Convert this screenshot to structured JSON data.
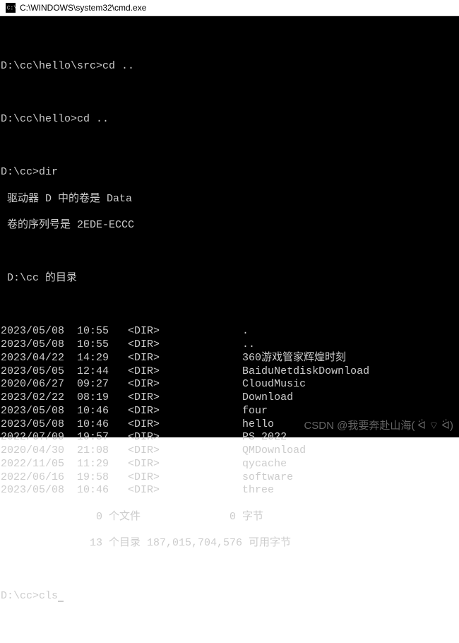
{
  "window": {
    "title": "C:\\WINDOWS\\system32\\cmd.exe"
  },
  "session": {
    "prompt1": "D:\\cc\\hello\\src>",
    "cmd1": "cd ..",
    "prompt2": "D:\\cc\\hello>",
    "cmd2": "cd ..",
    "prompt3": "D:\\cc>",
    "cmd3": "dir",
    "vol_line": " 驱动器 D 中的卷是 Data",
    "serial_line": " 卷的序列号是 2EDE-ECCC",
    "dir_of_line": " D:\\cc 的目录",
    "entries": [
      {
        "date": "2023/05/08",
        "time": "10:55",
        "type": "<DIR>",
        "name": "."
      },
      {
        "date": "2023/05/08",
        "time": "10:55",
        "type": "<DIR>",
        "name": ".."
      },
      {
        "date": "2023/04/22",
        "time": "14:29",
        "type": "<DIR>",
        "name": "360游戏管家辉煌时刻"
      },
      {
        "date": "2023/05/05",
        "time": "12:44",
        "type": "<DIR>",
        "name": "BaiduNetdiskDownload"
      },
      {
        "date": "2020/06/27",
        "time": "09:27",
        "type": "<DIR>",
        "name": "CloudMusic"
      },
      {
        "date": "2023/02/22",
        "time": "08:19",
        "type": "<DIR>",
        "name": "Download"
      },
      {
        "date": "2023/05/08",
        "time": "10:46",
        "type": "<DIR>",
        "name": "four"
      },
      {
        "date": "2023/05/08",
        "time": "10:46",
        "type": "<DIR>",
        "name": "hello"
      },
      {
        "date": "2022/07/09",
        "time": "19:57",
        "type": "<DIR>",
        "name": "PS 2022"
      },
      {
        "date": "2020/04/30",
        "time": "21:08",
        "type": "<DIR>",
        "name": "QMDownload"
      },
      {
        "date": "2022/11/05",
        "time": "11:29",
        "type": "<DIR>",
        "name": "qycache"
      },
      {
        "date": "2022/06/16",
        "time": "19:58",
        "type": "<DIR>",
        "name": "software"
      },
      {
        "date": "2023/05/08",
        "time": "10:46",
        "type": "<DIR>",
        "name": "three"
      }
    ],
    "summary_files": "               0 个文件              0 字节",
    "summary_dirs": "              13 个目录 187,015,704,576 可用字节",
    "prompt4": "D:\\cc>",
    "cmd4": "cls"
  },
  "watermark": "CSDN @我要奔赴山海( ᐛ ⌔ ᐛ)"
}
